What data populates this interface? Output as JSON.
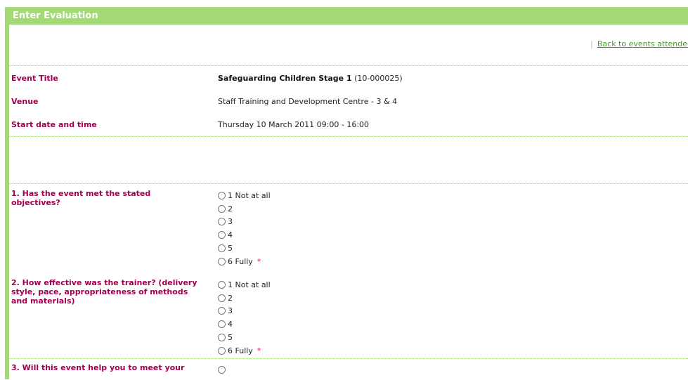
{
  "panel": {
    "title": "Enter Evaluation",
    "separator": "|",
    "back_link": "Back to events attended"
  },
  "details": [
    {
      "label": "Event Title",
      "value_bold": "Safeguarding Children Stage 1",
      "value_rest": " (10-000025)"
    },
    {
      "label": "Venue",
      "value": "Staff Training and Development Centre - 3 & 4"
    },
    {
      "label": "Start date and time",
      "value": "Thursday 10 March 2011 09:00 - 16:00"
    }
  ],
  "questions": [
    {
      "label": "1. Has the event met the stated objectives?",
      "options": [
        "1 Not at all",
        "2",
        "3",
        "4",
        "5",
        "6 Fully"
      ],
      "required_mark": "*"
    },
    {
      "label": "2. How effective was the trainer? (delivery style, pace, appropriateness of methods and materials)",
      "options": [
        "1 Not at all",
        "2",
        "3",
        "4",
        "5",
        "6 Fully"
      ],
      "required_mark": "*"
    },
    {
      "label": "3. Will this event help you to meet your",
      "options": [],
      "required_mark": ""
    }
  ],
  "colors": {
    "accent": "#a3d977",
    "label": "#a0004f",
    "required": "#c81d3b",
    "link": "#4a9a2c"
  }
}
